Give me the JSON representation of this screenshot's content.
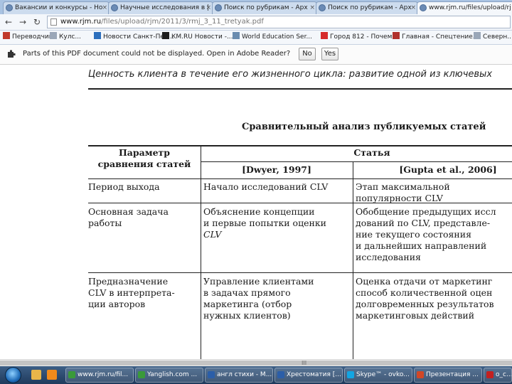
{
  "browser": {
    "tabs": [
      {
        "title": "Вакансии и конкурсы - Но",
        "active": false
      },
      {
        "title": "Научные исследования в |",
        "active": false
      },
      {
        "title": "Поиск по рубрикам - Арх",
        "active": false
      },
      {
        "title": "Поиск по рубрикам - Арх",
        "active": false
      },
      {
        "title": "www.rjm.ru/files/upload/rj",
        "active": true
      }
    ],
    "tab_close_glyph": "×",
    "url_host": "www.rjm.ru",
    "url_path": "/files/upload/rjm/2011/3/rmj_3_11_tretyak.pdf",
    "nav": {
      "back": "←",
      "forward": "→",
      "reload": "↻"
    },
    "bookmarks": [
      {
        "label": "Переводчик",
        "icon": "translator-icon",
        "color": "#c0392b"
      },
      {
        "label": "Кулс...",
        "icon": "page-icon",
        "color": "#9aa7b8"
      },
      {
        "label": "Новости Санкт-Пет...",
        "icon": "news-icon",
        "color": "#2c6fbd"
      },
      {
        "label": "КМ.RU Новости -...",
        "icon": "km-icon",
        "color": "#1d1d1d"
      },
      {
        "label": "World Education Ser...",
        "icon": "globe-icon",
        "color": "#6a8caf"
      },
      {
        "label": "Город 812 - Почем...",
        "icon": "city-icon",
        "color": "#d62b2b"
      },
      {
        "label": "Главная - Спецтение...",
        "icon": "home-icon",
        "color": "#b0302c"
      },
      {
        "label": "Северн...",
        "icon": "page-icon",
        "color": "#9aa7b8"
      }
    ],
    "infobar": {
      "message": "Parts of this PDF document could not be displayed. Open in Adobe Reader?",
      "no_label": "No",
      "yes_label": "Yes"
    }
  },
  "document": {
    "running_header": "Ценность клиента в течение его жизненного цикла: развитие одной из ключевых",
    "title": "Сравнительный анализ публикуемых статей",
    "table": {
      "param_header": [
        "Параметр",
        "сравнения статей"
      ],
      "group_header": "Статья",
      "col1_header": "[Dwyer, 1997]",
      "col2_header": "[Gupta et al., 2006]",
      "rows": [
        {
          "param": [
            "Период выхода"
          ],
          "col1": [
            "Начало исследований CLV"
          ],
          "col2": [
            "Этап максимальной",
            "популярности CLV"
          ]
        },
        {
          "param": [
            "Основная задача",
            "работы"
          ],
          "col1": [
            "Объяснение концепции",
            "и первые попытки оценки",
            "CLV"
          ],
          "col2": [
            "Обобщение предыдущих иссл",
            "дований по CLV, представле-",
            "ние текущего состояния",
            "и дальнейших направлений",
            "исследования"
          ]
        },
        {
          "param": [
            "Предназначение",
            "CLV в интерпрета-",
            "ции авторов"
          ],
          "col1": [
            "Управление клиентами",
            "в задачах прямого",
            "маркетинга (отбор",
            "нужных клиентов)"
          ],
          "col2": [
            "Оценка отдачи от маркетинг",
            "способ количественной оцен",
            "долговременных результатов",
            "маркетинговых действий"
          ]
        }
      ]
    }
  },
  "scrollbar": {
    "grip": "III"
  },
  "taskbar": {
    "pinned": [
      {
        "icon": "windows-explorer-icon",
        "color": "#e9b64a"
      },
      {
        "icon": "media-player-icon",
        "color": "#f08a1c"
      }
    ],
    "tasks": [
      {
        "label": "www.rjm.ru/fil...",
        "icon": "chrome-icon",
        "color": "#3a9a3a"
      },
      {
        "label": "Yanglish.com ...",
        "icon": "chrome-icon",
        "color": "#3a9a3a"
      },
      {
        "label": "англ стихи - M...",
        "icon": "word-icon",
        "color": "#2b5ea8"
      },
      {
        "label": "Хрестоматия [...",
        "icon": "word-icon",
        "color": "#2b5ea8"
      },
      {
        "label": "Skype™ - ovko...",
        "icon": "skype-icon",
        "color": "#12a5e3"
      },
      {
        "label": "Презентация ...",
        "icon": "powerpoint-icon",
        "color": "#d24726"
      },
      {
        "label": "o_c...",
        "icon": "pdf-icon",
        "color": "#c32020"
      }
    ]
  }
}
